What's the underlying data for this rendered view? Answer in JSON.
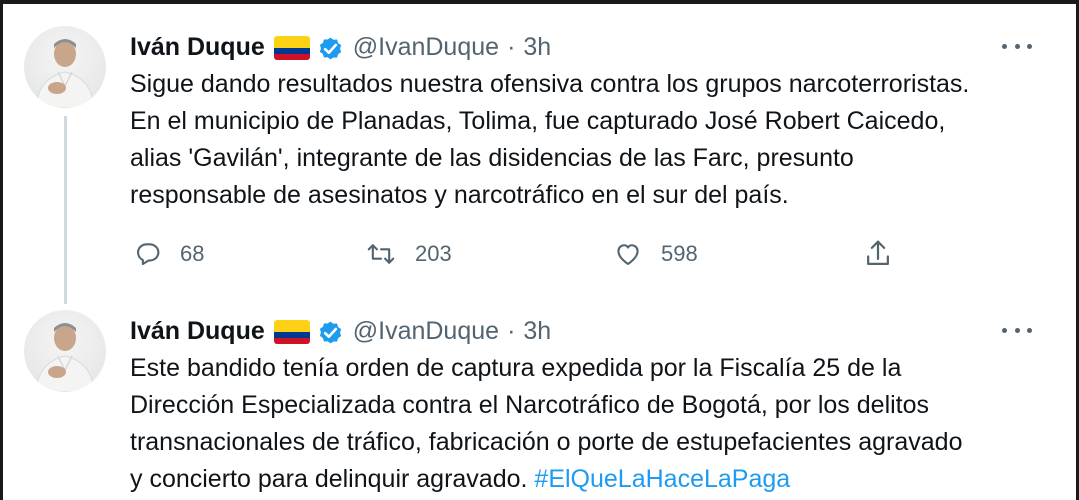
{
  "tweets": [
    {
      "author": {
        "name": "Iván Duque",
        "handle": "@IvanDuque",
        "flag": "colombia-flag",
        "verified": true
      },
      "separator": "·",
      "time": "3h",
      "text": "Sigue dando resultados nuestra ofensiva contra los grupos narcoterroristas.\nEn el municipio de Planadas, Tolima, fue capturado José Robert Caicedo,\nalias 'Gavilán', integrante de las disidencias de las Farc, presunto\nresponsable de asesinatos y narcotráfico en el sur del país.",
      "stats": {
        "replies": "68",
        "retweets": "203",
        "likes": "598"
      }
    },
    {
      "author": {
        "name": "Iván Duque",
        "handle": "@IvanDuque",
        "flag": "colombia-flag",
        "verified": true
      },
      "separator": "·",
      "time": "3h",
      "text": "Este bandido tenía orden de captura expedida por la Fiscalía 25 de la\nDirección Especializada contra el Narcotráfico de Bogotá, por los delitos\ntransnacionales de tráfico, fabricación o porte de estupefacientes agravado\ny concierto para delinquir agravado. ",
      "hashtag": "#ElQueLaHaceLaPaga"
    }
  ],
  "icons": {
    "more": "more-horizontal-icon",
    "reply": "reply-icon",
    "retweet": "retweet-icon",
    "like": "heart-icon",
    "share": "share-icon",
    "verified": "verified-badge-icon"
  },
  "colors": {
    "text": "#0f1419",
    "secondary": "#536471",
    "accent": "#1d9bf0",
    "thread_line": "#cfd9de"
  }
}
